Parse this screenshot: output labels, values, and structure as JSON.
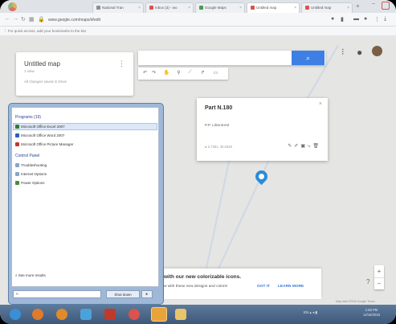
{
  "browser": {
    "tabs": [
      {
        "label": "National Tran",
        "color": "#8e8e8e"
      },
      {
        "label": "Inbox (3) - wo",
        "color": "#d9534f"
      },
      {
        "label": "Google Maps",
        "color": "#4c9a55"
      },
      {
        "label": "Untitled map",
        "color": "#d9534f"
      },
      {
        "label": "Untitled map",
        "color": "#d9534f"
      }
    ],
    "url": "www.google.com/maps/d/edit",
    "bookmarks_hint": "For quick access, add your bookmarks to the bar"
  },
  "map_panel": {
    "title": "Untitled map",
    "subtitle": "1 view",
    "save_status": "All changes saved in Drive"
  },
  "info_window": {
    "title": "Part N.180",
    "description": "P.P. Littentorst",
    "coords": "● 2.7351, 30.0330"
  },
  "start_menu": {
    "programs_header": "Programs (19)",
    "programs": [
      {
        "label": "Microsoft Office Excel 2007",
        "color": "#2e7d32"
      },
      {
        "label": "Microsoft Office Word 2007",
        "color": "#2a5fb3"
      },
      {
        "label": "Microsoft Office Picture Manager",
        "color": "#c0392b"
      }
    ],
    "control_header": "Control Panel",
    "control_items": [
      {
        "label": "Troubleshooting",
        "color": "#8aa4c8"
      },
      {
        "label": "Internet Options",
        "color": "#8aa4c8"
      },
      {
        "label": "Power Options",
        "color": "#4c8a3c"
      }
    ],
    "see_more": "See more results",
    "search_value": "e",
    "shutdown_label": "Shut down"
  },
  "banner": {
    "title": "with our new colorizable icons.",
    "subtitle": "w with these new designs and colors!",
    "got_it": "GOT IT",
    "learn_more": "LEARN MORE"
  },
  "map_footer": "Map data ©2016 Google  Terms",
  "taskbar": {
    "tray_text": "EN",
    "time": "1:58 PM",
    "date": "12/16/2016",
    "icons": [
      {
        "name": "start-orb-icon",
        "color": "#3a8fd6"
      },
      {
        "name": "firefox-icon",
        "color": "#e07b2c"
      },
      {
        "name": "media-player-icon",
        "color": "#e08a2c"
      },
      {
        "name": "paint-icon",
        "color": "#4aa3d8"
      },
      {
        "name": "acrobat-icon",
        "color": "#c0392b"
      },
      {
        "name": "chrome-icon",
        "color": "#d9534f"
      },
      {
        "name": "chrome-active-icon",
        "color": "#e8a33a"
      },
      {
        "name": "explorer-icon",
        "color": "#e8c46a"
      }
    ]
  }
}
